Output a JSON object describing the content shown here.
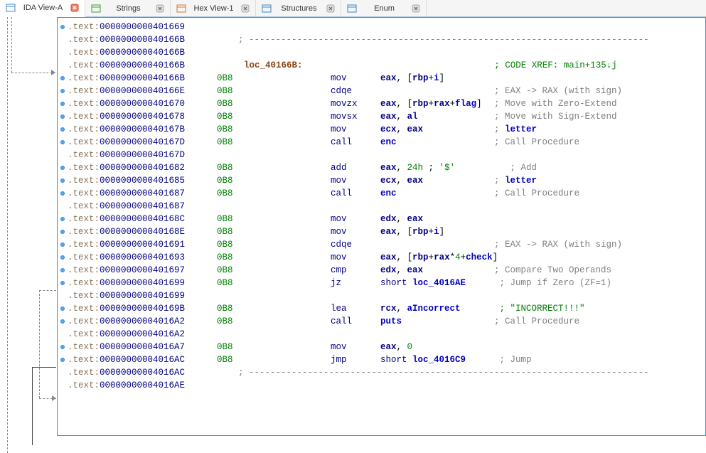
{
  "tabs": [
    {
      "label": "IDA View-A",
      "iconColor": "#3c88d0",
      "active": true
    },
    {
      "label": "Strings",
      "iconColor": "#3ca030",
      "active": false
    },
    {
      "label": "Hex View-1",
      "iconColor": "#d07830",
      "active": false
    },
    {
      "label": "Structures",
      "iconColor": "#3c88d0",
      "active": false
    },
    {
      "label": "Enum",
      "iconColor": "#3c88d0",
      "active": false
    }
  ],
  "lines": [
    {
      "dot": true,
      "addr": "0000000000401669",
      "sp": "",
      "body": ""
    },
    {
      "dot": false,
      "addr": "000000000040166B",
      "sp": "",
      "body": "dashline"
    },
    {
      "dot": false,
      "addr": "000000000040166B",
      "sp": "",
      "body": ""
    },
    {
      "dot": false,
      "addr": "000000000040166B",
      "sp": "",
      "body": "loclabel",
      "label": "loc_40166B:",
      "xref": "; CODE XREF: main+135↓j"
    },
    {
      "dot": true,
      "addr": "000000000040166B",
      "sp": "0B8",
      "mn": "mov",
      "ops": [
        [
          "reg",
          "eax"
        ],
        [
          "txt",
          ", ["
        ],
        [
          "reg",
          "rbp"
        ],
        [
          "txt",
          "+"
        ],
        [
          "glb",
          "i"
        ],
        [
          "txt",
          "]"
        ]
      ]
    },
    {
      "dot": true,
      "addr": "000000000040166E",
      "sp": "0B8",
      "mn": "cdqe",
      "ops": [],
      "cmt": "; EAX -> RAX (with sign)"
    },
    {
      "dot": true,
      "addr": "0000000000401670",
      "sp": "0B8",
      "mn": "movzx",
      "ops": [
        [
          "reg",
          "eax"
        ],
        [
          "txt",
          ", ["
        ],
        [
          "reg",
          "rbp"
        ],
        [
          "txt",
          "+"
        ],
        [
          "reg",
          "rax"
        ],
        [
          "txt",
          "+"
        ],
        [
          "glb",
          "flag"
        ],
        [
          "txt",
          "]"
        ]
      ],
      "cmt": "; Move with Zero-Extend"
    },
    {
      "dot": true,
      "addr": "0000000000401678",
      "sp": "0B8",
      "mn": "movsx",
      "ops": [
        [
          "reg",
          "eax"
        ],
        [
          "txt",
          ", "
        ],
        [
          "reg",
          "al"
        ]
      ],
      "cmt": "; Move with Sign-Extend"
    },
    {
      "dot": true,
      "addr": "000000000040167B",
      "sp": "0B8",
      "mn": "mov",
      "ops": [
        [
          "reg",
          "ecx"
        ],
        [
          "txt",
          ", "
        ],
        [
          "reg",
          "eax"
        ]
      ],
      "cmt": "; ",
      "cmtglb": "letter"
    },
    {
      "dot": true,
      "addr": "000000000040167D",
      "sp": "0B8",
      "mn": "call",
      "ops": [
        [
          "glb",
          "enc"
        ]
      ],
      "cmt": "; Call Procedure"
    },
    {
      "dot": false,
      "addr": "000000000040167D",
      "sp": "",
      "body": ""
    },
    {
      "dot": true,
      "addr": "0000000000401682",
      "sp": "0B8",
      "mn": "add",
      "ops": [
        [
          "reg",
          "eax"
        ],
        [
          "txt",
          ", "
        ],
        [
          "num",
          "24h"
        ],
        [
          "txt",
          " ; "
        ],
        [
          "str",
          "'$'"
        ]
      ],
      "cmtplain": "   ; Add"
    },
    {
      "dot": true,
      "addr": "0000000000401685",
      "sp": "0B8",
      "mn": "mov",
      "ops": [
        [
          "reg",
          "ecx"
        ],
        [
          "txt",
          ", "
        ],
        [
          "reg",
          "eax"
        ]
      ],
      "cmt": "; ",
      "cmtglb": "letter"
    },
    {
      "dot": true,
      "addr": "0000000000401687",
      "sp": "0B8",
      "mn": "call",
      "ops": [
        [
          "glb",
          "enc"
        ]
      ],
      "cmt": "; Call Procedure"
    },
    {
      "dot": false,
      "addr": "0000000000401687",
      "sp": "",
      "body": ""
    },
    {
      "dot": true,
      "addr": "000000000040168C",
      "sp": "0B8",
      "mn": "mov",
      "ops": [
        [
          "reg",
          "edx"
        ],
        [
          "txt",
          ", "
        ],
        [
          "reg",
          "eax"
        ]
      ]
    },
    {
      "dot": true,
      "addr": "000000000040168E",
      "sp": "0B8",
      "mn": "mov",
      "ops": [
        [
          "reg",
          "eax"
        ],
        [
          "txt",
          ", ["
        ],
        [
          "reg",
          "rbp"
        ],
        [
          "txt",
          "+"
        ],
        [
          "glb",
          "i"
        ],
        [
          "txt",
          "]"
        ]
      ]
    },
    {
      "dot": true,
      "addr": "0000000000401691",
      "sp": "0B8",
      "mn": "cdqe",
      "ops": [],
      "cmt": "; EAX -> RAX (with sign)"
    },
    {
      "dot": true,
      "addr": "0000000000401693",
      "sp": "0B8",
      "mn": "mov",
      "ops": [
        [
          "reg",
          "eax"
        ],
        [
          "txt",
          ", ["
        ],
        [
          "reg",
          "rbp"
        ],
        [
          "txt",
          "+"
        ],
        [
          "reg",
          "rax"
        ],
        [
          "txt",
          "*"
        ],
        [
          "num",
          "4"
        ],
        [
          "txt",
          "+"
        ],
        [
          "glb",
          "check"
        ],
        [
          "txt",
          "]"
        ]
      ]
    },
    {
      "dot": true,
      "addr": "0000000000401697",
      "sp": "0B8",
      "mn": "cmp",
      "ops": [
        [
          "reg",
          "edx"
        ],
        [
          "txt",
          ", "
        ],
        [
          "reg",
          "eax"
        ]
      ],
      "cmt": "; Compare Two Operands"
    },
    {
      "dot": true,
      "addr": "0000000000401699",
      "sp": "0B8",
      "mn": "jz",
      "ops": [
        [
          "mn",
          "short "
        ],
        [
          "glb",
          "loc_4016AE"
        ]
      ],
      "cmt": " ; Jump if Zero (ZF=1)"
    },
    {
      "dot": false,
      "addr": "0000000000401699",
      "sp": "",
      "body": ""
    },
    {
      "dot": true,
      "addr": "000000000040169B",
      "sp": "0B8",
      "mn": "lea",
      "ops": [
        [
          "reg",
          "rcx"
        ],
        [
          "txt",
          ", "
        ],
        [
          "glb",
          "aIncorrect"
        ]
      ],
      "cmtstr": " ; \"INCORRECT!!!\""
    },
    {
      "dot": true,
      "addr": "00000000004016A2",
      "sp": "0B8",
      "mn": "call",
      "ops": [
        [
          "glb",
          "puts"
        ]
      ],
      "cmt": "; Call Procedure"
    },
    {
      "dot": false,
      "addr": "00000000004016A2",
      "sp": "",
      "body": ""
    },
    {
      "dot": true,
      "addr": "00000000004016A7",
      "sp": "0B8",
      "mn": "mov",
      "ops": [
        [
          "reg",
          "eax"
        ],
        [
          "txt",
          ", "
        ],
        [
          "num",
          "0"
        ]
      ]
    },
    {
      "dot": true,
      "addr": "00000000004016AC",
      "sp": "0B8",
      "mn": "jmp",
      "ops": [
        [
          "mn",
          "short "
        ],
        [
          "glb",
          "loc_4016C9"
        ]
      ],
      "cmt": " ; Jump"
    },
    {
      "dot": false,
      "addr": "00000000004016AC",
      "sp": "",
      "body": "dashline"
    },
    {
      "dot": false,
      "addr": "00000000004016AE",
      "sp": "",
      "body": ""
    }
  ],
  "segName": ".text:",
  "dashSep": "; ---------------------------------------------------------------------------"
}
